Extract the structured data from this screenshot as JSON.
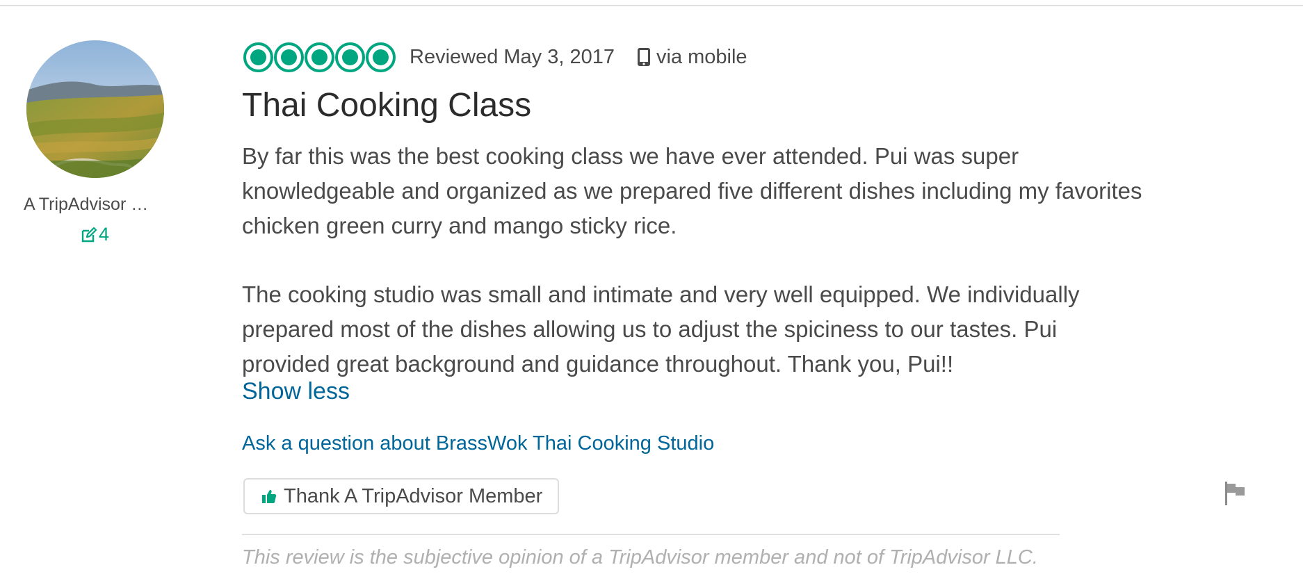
{
  "member": {
    "name": "A TripAdvisor …",
    "contribution_count": "4",
    "avatar_icon": "landscape-photo",
    "contribution_icon": "edit-icon"
  },
  "review": {
    "rating": 5,
    "rating_max": 5,
    "date_text": "Reviewed May 3, 2017",
    "via_text": "via mobile",
    "via_icon": "mobile-phone-icon",
    "title": "Thai Cooking Class",
    "paragraphs": [
      "By far this was the best cooking class we have ever attended. Pui was super knowledgeable and organized as we prepared five different dishes including my favorites chicken green curry and mango sticky rice.",
      "The cooking studio was small and intimate and very well equipped. We individually prepared most of the dishes allowing us to adjust the spiciness to our tastes. Pui provided great background and guidance throughout. Thank you, Pui!!"
    ],
    "show_less_label": "Show less",
    "ask_question_label": "Ask a question about BrassWok Thai Cooking Studio",
    "thank_button_label": "Thank A TripAdvisor Member",
    "thank_icon": "thumbs-up-icon",
    "flag_icon": "flag-icon"
  },
  "disclaimer": "This review is the subjective opinion of a TripAdvisor member and not of TripAdvisor LLC.",
  "colors": {
    "accent_green": "#00a680",
    "link_blue": "#006699",
    "text_gray": "#4a4a4a",
    "disclaimer_gray": "#b0b0b0"
  }
}
